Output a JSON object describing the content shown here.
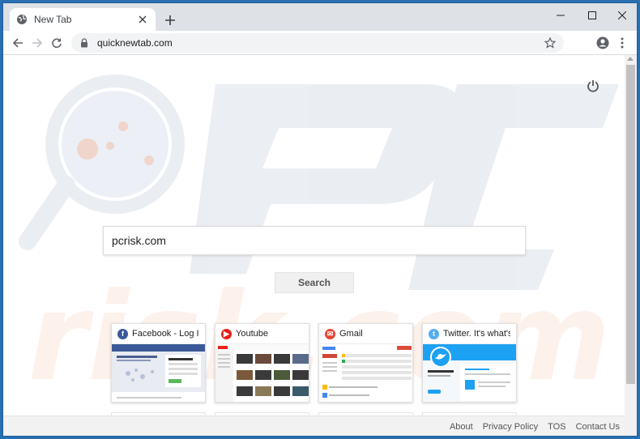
{
  "browser": {
    "tab_title": "New Tab",
    "url": "quicknewtab.com"
  },
  "search": {
    "value": "pcrisk.com",
    "button_label": "Search"
  },
  "shortcuts": [
    {
      "label": "Facebook - Log In...",
      "icon": "facebook-icon",
      "color": "#3b5998"
    },
    {
      "label": "Youtube",
      "icon": "youtube-icon",
      "color": "#e62117"
    },
    {
      "label": "Gmail",
      "icon": "gmail-icon",
      "color": "#ea4335"
    },
    {
      "label": "Twitter. It's what's...",
      "icon": "twitter-icon",
      "color": "#55acee"
    }
  ],
  "footer": {
    "links": [
      "About",
      "Privacy Policy",
      "TOS",
      "Contact Us"
    ]
  }
}
